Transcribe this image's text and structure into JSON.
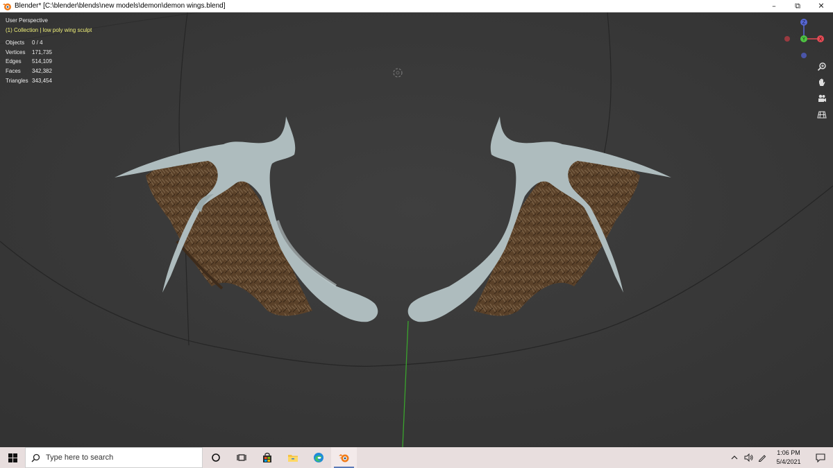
{
  "window": {
    "title": "Blender* [C:\\blender\\blends\\new models\\demon\\demon wings.blend]",
    "minimize_glyph": "–",
    "restore_glyph": "⧉",
    "close_glyph": "✕"
  },
  "viewport": {
    "view_name": "User Perspective",
    "collection_line": "(1) Collection | low poly wing sculpt",
    "stats": [
      {
        "label": "Objects",
        "value": "0 / 4"
      },
      {
        "label": "Vertices",
        "value": "171,735"
      },
      {
        "label": "Edges",
        "value": "514,109"
      },
      {
        "label": "Faces",
        "value": "342,382"
      },
      {
        "label": "Triangles",
        "value": "343,454"
      }
    ],
    "gizmo_axes": {
      "x": "X",
      "y": "Y",
      "z": "Z"
    },
    "nav_tools": [
      "zoom-icon",
      "hand-pan-icon",
      "camera-icon",
      "grid-view-icon"
    ]
  },
  "colors": {
    "viewport_bg": "#3d3d3d",
    "wing_bone": "#aebcbe",
    "wing_membrane": "#5e4630",
    "axis_x": "#e54b55",
    "axis_y": "#4fc443",
    "axis_z": "#5768d6",
    "collection_text": "#f0f07a"
  },
  "taskbar": {
    "search_placeholder": "Type here to search",
    "time": "1:06 PM",
    "date": "5/4/2021",
    "pinned": [
      "cortana-icon",
      "task-view-icon",
      "store-icon",
      "file-explorer-icon",
      "edge-icon",
      "blender-icon"
    ]
  }
}
